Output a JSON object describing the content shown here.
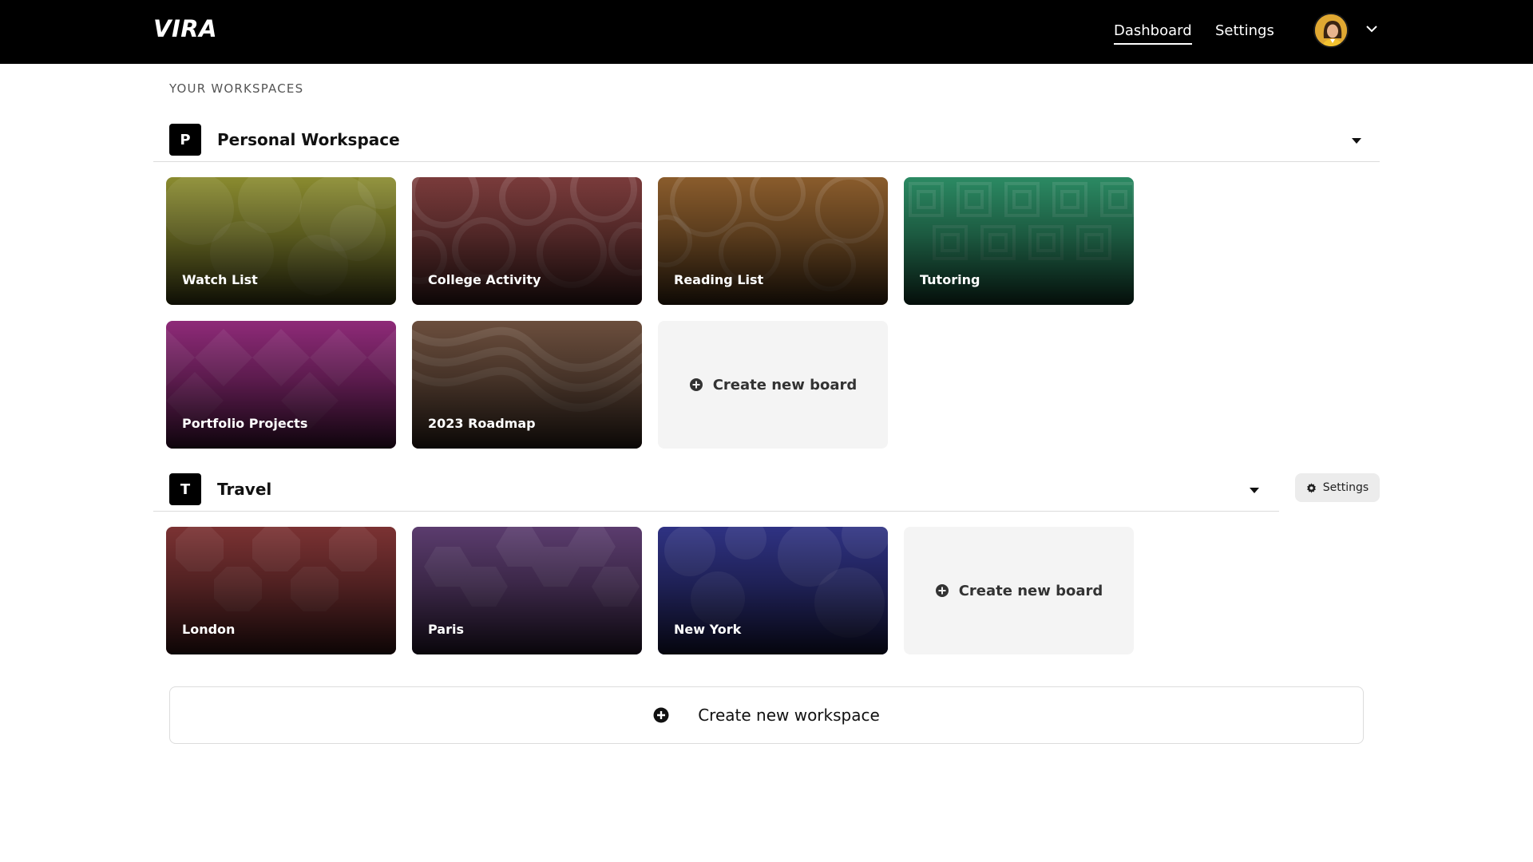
{
  "app": {
    "logo": "VIRA"
  },
  "nav": {
    "dashboard": "Dashboard",
    "settings": "Settings"
  },
  "section_label": "YOUR WORKSPACES",
  "workspaces": [
    {
      "badge": "P",
      "name": "Personal Workspace",
      "boards": [
        {
          "title": "Watch List",
          "color": "#8a8b2f"
        },
        {
          "title": "College Activity",
          "color": "#7a3b3b"
        },
        {
          "title": "Reading List",
          "color": "#8a5c2c"
        },
        {
          "title": "Tutoring",
          "color": "#2b8a63"
        },
        {
          "title": "Portfolio Projects",
          "color": "#8e2a78"
        },
        {
          "title": "2023 Roadmap",
          "color": "#6b4e3d"
        }
      ],
      "create_board": "Create new board"
    },
    {
      "badge": "T",
      "name": "Travel",
      "settings_label": "Settings",
      "boards": [
        {
          "title": "London",
          "color": "#7b3233"
        },
        {
          "title": "Paris",
          "color": "#5b3c6e"
        },
        {
          "title": "New York",
          "color": "#2f3283"
        }
      ],
      "create_board": "Create new board"
    }
  ],
  "create_workspace": "Create new workspace",
  "icons": {
    "caret": "caret-down-icon",
    "plus": "plus-circle-icon",
    "gear": "gear-icon",
    "chevron": "chevron-down-icon"
  }
}
